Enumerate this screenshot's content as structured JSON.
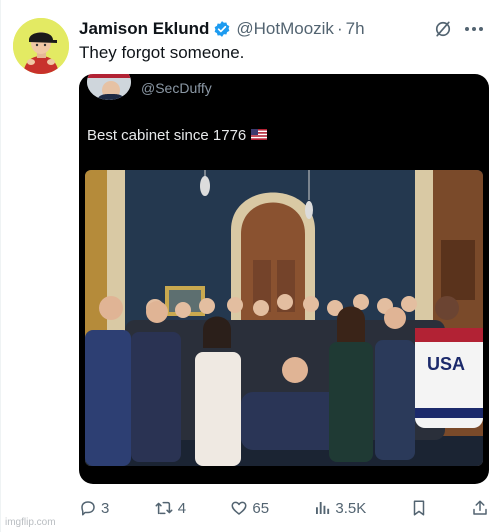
{
  "author": {
    "display_name": "Jamison Eklund",
    "handle": "@HotMoozik",
    "separator": "·",
    "time": "7h",
    "verified": true,
    "avatar_bg": "#e3ea63"
  },
  "tweet": {
    "text": "They forgot someone."
  },
  "quoted": {
    "handle": "@SecDuffy",
    "text": "Best cabinet since 1776",
    "flag_icon": "us-flag-icon"
  },
  "icons": {
    "verified": "verified-badge-icon",
    "grok": "grok-icon",
    "more": "more-options-icon"
  },
  "actions": {
    "replies": "3",
    "reposts": "4",
    "likes": "65",
    "views": "3.5K"
  },
  "watermark": "imgflip.com",
  "colors": {
    "accent": "#1d9bf0",
    "secondary_text": "#536471",
    "media_bg": "#000000"
  }
}
